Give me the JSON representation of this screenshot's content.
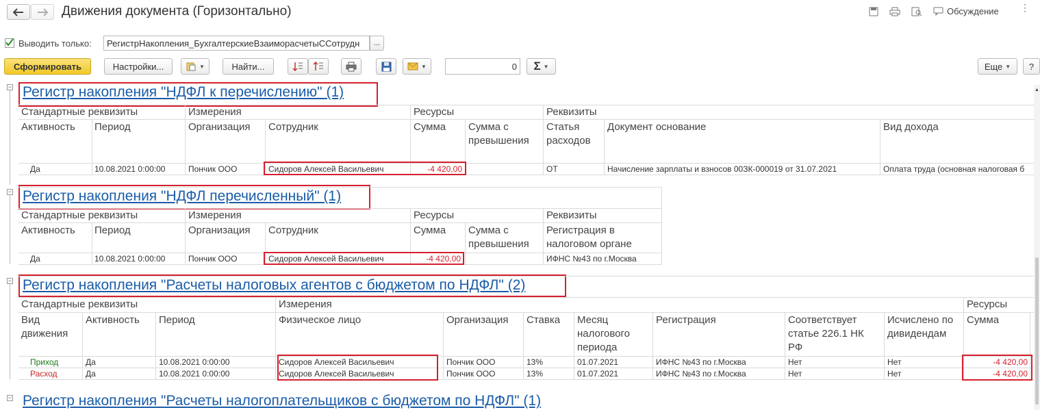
{
  "window": {
    "title": "Движения документа (Горизонтально)",
    "discussion_label": "Обсуждение"
  },
  "filter": {
    "label": "Выводить только:",
    "value": "РегистрНакопления_БухгалтерскиеВзаиморасчетыССотрудн",
    "more": "..."
  },
  "toolbar": {
    "generate": "Сформировать",
    "settings": "Настройки...",
    "find": "Найти...",
    "number_value": "0",
    "sum_symbol": "Σ",
    "more": "Еще",
    "help": "?"
  },
  "colors": {
    "accent_button": "#f5d33a",
    "link": "#1a5ca8",
    "highlight_box": "#d4202d",
    "negative": "#d4202d"
  },
  "sections": [
    {
      "title": "Регистр накопления \"НДФЛ к перечислению\" (1)",
      "groups": [
        "Стандартные реквизиты",
        "Измерения",
        "Ресурсы",
        "Реквизиты"
      ],
      "columns": [
        "Активность",
        "Период",
        "Организация",
        "Сотрудник",
        "Сумма",
        "Сумма с превышения",
        "Статья расходов",
        "Документ основание",
        "Вид дохода"
      ],
      "rows": [
        [
          "Да",
          "10.08.2021 0:00:00",
          "Пончик ООО",
          "Сидоров Алексей Васильевич",
          "-4 420,00",
          "",
          "ОТ",
          "Начисление зарплаты и взносов 00ЗК-000019 от 31.07.2021",
          "Оплата труда (основная налоговая б"
        ]
      ]
    },
    {
      "title": "Регистр накопления \"НДФЛ перечисленный\" (1)",
      "groups": [
        "Стандартные реквизиты",
        "Измерения",
        "Ресурсы",
        "Реквизиты"
      ],
      "columns": [
        "Активность",
        "Период",
        "Организация",
        "Сотрудник",
        "Сумма",
        "Сумма с превышения",
        "Регистрация в налоговом органе"
      ],
      "rows": [
        [
          "Да",
          "10.08.2021 0:00:00",
          "Пончик ООО",
          "Сидоров Алексей Васильевич",
          "-4 420,00",
          "",
          "ИФНС №43 по г.Москва"
        ]
      ]
    },
    {
      "title": "Регистр накопления \"Расчеты налоговых агентов с бюджетом по НДФЛ\" (2)",
      "groups": [
        "Стандартные реквизиты",
        "Измерения",
        "Ресурсы"
      ],
      "columns": [
        "Вид движения",
        "Активность",
        "Период",
        "Физическое лицо",
        "Организация",
        "Ставка",
        "Месяц налогового периода",
        "Регистрация",
        "Соответствует статье 226.1 НК РФ",
        "Исчислено по дивидендам",
        "Сумма"
      ],
      "rows": [
        [
          "Приход",
          "Да",
          "10.08.2021 0:00:00",
          "Сидоров Алексей Васильевич",
          "Пончик ООО",
          "13%",
          "01.07.2021",
          "ИФНС №43 по г.Москва",
          "Нет",
          "Нет",
          "-4 420,00"
        ],
        [
          "Расход",
          "Да",
          "10.08.2021 0:00:00",
          "Сидоров Алексей Васильевич",
          "Пончик ООО",
          "13%",
          "01.07.2021",
          "ИФНС №43 по г.Москва",
          "Нет",
          "Нет",
          "-4 420,00"
        ]
      ]
    },
    {
      "title": "Регистр накопления \"Расчеты налогоплательщиков с бюджетом по НДФЛ\" (1)"
    }
  ]
}
